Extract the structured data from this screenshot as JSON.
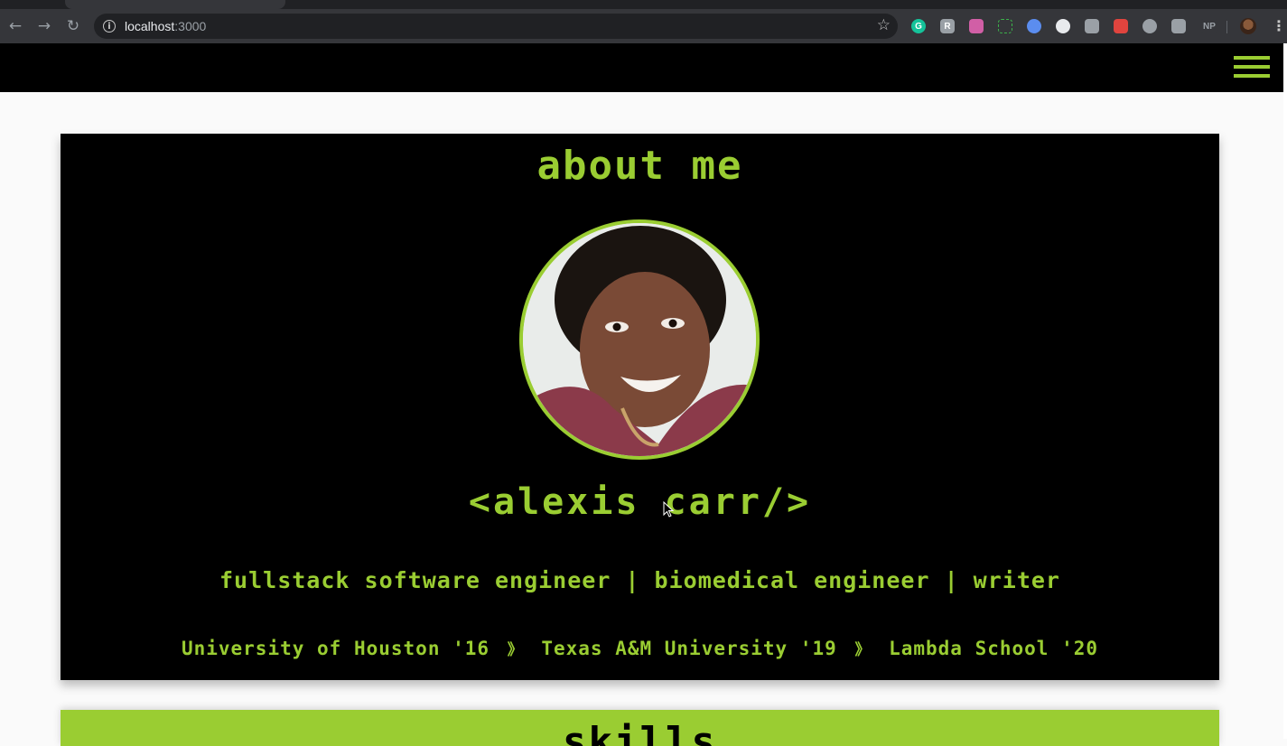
{
  "browser": {
    "url_host": "localhost",
    "url_port": ":3000",
    "extensions": [
      {
        "name": "grammarly-icon",
        "glyph": "G",
        "color": "#15c39a"
      },
      {
        "name": "extension-r-icon",
        "glyph": "R",
        "color": "#9aa0a6"
      },
      {
        "name": "extension-pink-icon",
        "glyph": "",
        "color": "#d15fa6"
      },
      {
        "name": "extension-dashed-icon",
        "glyph": "",
        "color": "#35363a"
      },
      {
        "name": "extension-blue-icon",
        "glyph": "",
        "color": "#5b8def"
      },
      {
        "name": "github-icon",
        "glyph": "",
        "color": "#e8eaed"
      },
      {
        "name": "extension-gear-icon",
        "glyph": "",
        "color": "#9aa0a6"
      },
      {
        "name": "extension-red-icon",
        "glyph": "",
        "color": "#e0443e"
      },
      {
        "name": "extension-target-icon",
        "glyph": "",
        "color": "#9aa0a6"
      },
      {
        "name": "extension-hex-icon",
        "glyph": "",
        "color": "#9aa0a6"
      },
      {
        "name": "extension-np-icon",
        "glyph": "NP",
        "color": "#35363a"
      }
    ]
  },
  "page": {
    "accent_color": "#9acd32",
    "about": {
      "title": "about me",
      "name": "<alexis carr/>",
      "roles": "fullstack software engineer | biomedical engineer | writer",
      "schools": [
        "University of Houston '16",
        "Texas A&M University '19",
        "Lambda School '20"
      ],
      "separator": "》"
    },
    "skills": {
      "title": "skills"
    }
  }
}
